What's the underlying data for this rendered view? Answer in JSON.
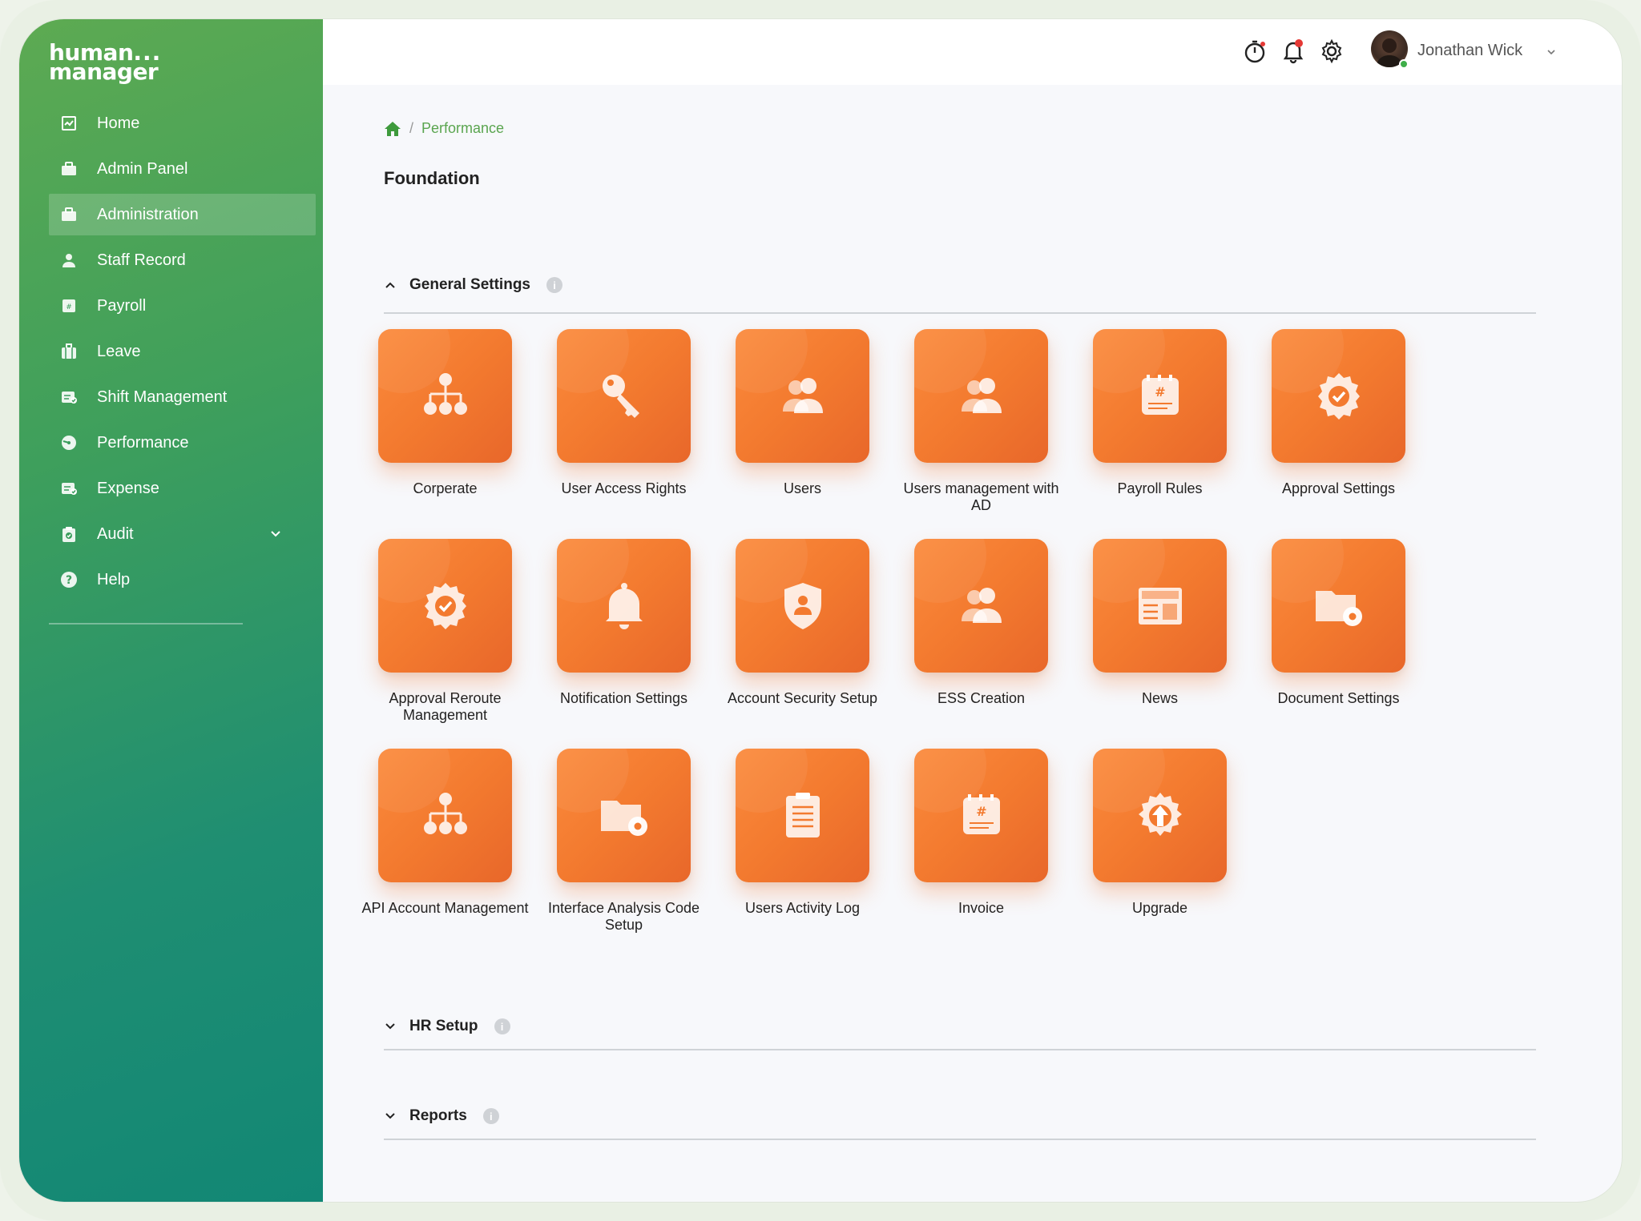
{
  "app": {
    "logo_line1": "human",
    "logo_dots": "...",
    "logo_line2": "manager"
  },
  "sidebar": {
    "items": [
      {
        "label": "Home",
        "icon": "home-dashboard-icon"
      },
      {
        "label": "Admin Panel",
        "icon": "briefcase-icon"
      },
      {
        "label": "Administration",
        "icon": "briefcase-icon",
        "active": true
      },
      {
        "label": "Staff Record",
        "icon": "person-icon"
      },
      {
        "label": "Payroll",
        "icon": "payroll-icon"
      },
      {
        "label": "Leave",
        "icon": "suitcase-icon"
      },
      {
        "label": "Shift Management",
        "icon": "shift-icon"
      },
      {
        "label": "Performance",
        "icon": "gauge-icon"
      },
      {
        "label": "Expense",
        "icon": "expense-icon"
      },
      {
        "label": "Audit",
        "icon": "clipboard-icon",
        "expandable": true
      },
      {
        "label": "Help",
        "icon": "help-icon"
      }
    ]
  },
  "header": {
    "user_name": "Jonathan Wick",
    "icons": [
      "timer-icon",
      "bell-icon",
      "settings-icon"
    ]
  },
  "breadcrumb": {
    "current": "Performance"
  },
  "page": {
    "title": "Foundation"
  },
  "sections": {
    "general": {
      "title": "General Settings",
      "info": "i"
    },
    "hr": {
      "title": "HR Setup",
      "info": "i"
    },
    "reports": {
      "title": "Reports",
      "info": "i"
    }
  },
  "tiles": [
    {
      "label": "Corperate",
      "icon": "org-chart-icon"
    },
    {
      "label": "User Access Rights",
      "icon": "key-icon"
    },
    {
      "label": "Users",
      "icon": "users-icon"
    },
    {
      "label": "Users management with AD",
      "icon": "users-icon"
    },
    {
      "label": "Payroll Rules",
      "icon": "calendar-hash-icon"
    },
    {
      "label": "Approval Settings",
      "icon": "badge-check-icon"
    },
    {
      "label": "Approval Reroute Management",
      "icon": "badge-check-icon"
    },
    {
      "label": "Notification Settings",
      "icon": "bell-icon"
    },
    {
      "label": "Account Security Setup",
      "icon": "shield-user-icon"
    },
    {
      "label": "ESS Creation",
      "icon": "users-icon"
    },
    {
      "label": "News",
      "icon": "newspaper-icon"
    },
    {
      "label": "Document Settings",
      "icon": "folder-gear-icon"
    },
    {
      "label": "API Account Management",
      "icon": "org-chart-icon"
    },
    {
      "label": "Interface Analysis Code Setup",
      "icon": "folder-gear-icon"
    },
    {
      "label": "Users Activity Log",
      "icon": "clipboard-list-icon"
    },
    {
      "label": "Invoice",
      "icon": "calendar-hash-icon"
    },
    {
      "label": "Upgrade",
      "icon": "upgrade-gear-icon"
    }
  ],
  "colors": {
    "sidebar_top": "#5daa52",
    "sidebar_bottom": "#128775",
    "tile_orange": "#f37a2f",
    "breadcrumb_green": "#5aa54f"
  }
}
